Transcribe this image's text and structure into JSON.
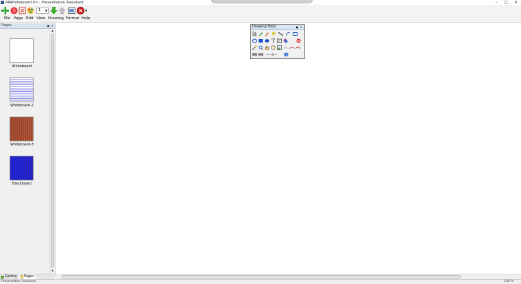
{
  "window": {
    "title": "PAWhiteboard.hh - Presentation Assistant",
    "controls": [
      "minimize",
      "maximize",
      "close"
    ]
  },
  "toolbar": {
    "page_number": "1",
    "buttons": [
      "add-page-icon",
      "delete-page-icon",
      "clear-page-icon",
      "color-page-icon",
      "next-page-icon",
      "previous-page-icon",
      "fullscreen-icon",
      "exit-icon"
    ]
  },
  "menu": [
    "File",
    "Page",
    "Edit",
    "View",
    "Drawing",
    "Format",
    "Help"
  ],
  "sidebar": {
    "header": "Pages",
    "pages": [
      {
        "label": "Whiteboard",
        "style": "white"
      },
      {
        "label": "Whiteboard-2",
        "style": "lined"
      },
      {
        "label": "Whiteboard-3",
        "style": "brick"
      },
      {
        "label": "Blackboard",
        "style": "blue"
      }
    ],
    "tabs": [
      "Gallery",
      "Pages"
    ]
  },
  "palette": {
    "title": "Drawing Tools",
    "rows": [
      [
        "select-arrow-icon",
        "pen-icon",
        "highlighter-icon",
        "fill-icon",
        "line-icon",
        "curve-icon",
        "rectangle-outline-icon"
      ],
      [
        "ellipse-outline-icon",
        "rectangle-filled-icon",
        "ellipse-filled-icon",
        "text-icon",
        "textbox-icon",
        "color-icon",
        "stop-icon"
      ],
      [
        "magic-wand-icon",
        "magnifier-icon",
        "hand-icon",
        "spotlight-icon",
        "image-icon",
        "link-icon",
        "screen-icon",
        "curtain-icon"
      ],
      [
        "line-width-icon",
        "keyboard-icon",
        "slider-icon",
        "info-icon"
      ]
    ]
  },
  "status": {
    "text": "Presentation Assistant",
    "right": "100 %"
  },
  "colors": {
    "accent": "#3a6ea5",
    "panel_header": "#d9e4f1",
    "blackboard": "#1f1fd8",
    "brick": "#c8866a"
  }
}
